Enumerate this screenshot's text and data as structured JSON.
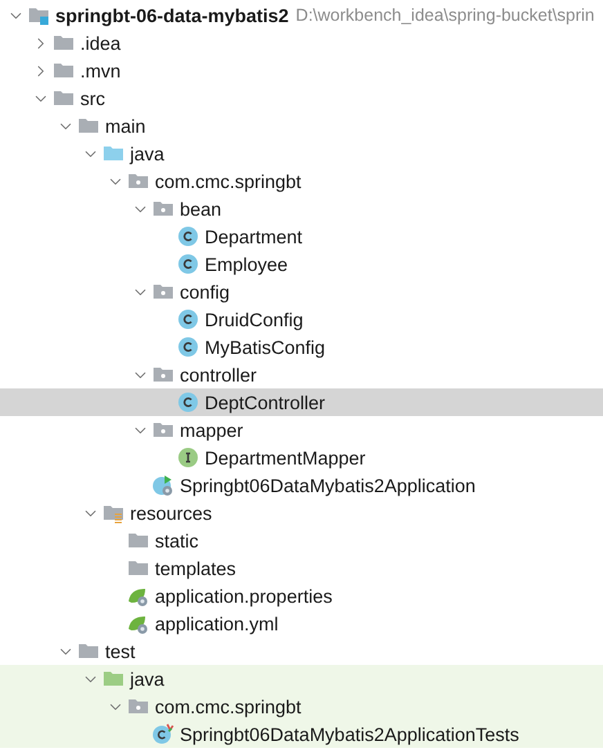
{
  "project_tree": [
    {
      "label": "springbt-06-data-mybatis2",
      "path": "D:\\workbench_idea\\spring-bucket\\sprin",
      "kind": "module",
      "expanded": true,
      "selected": false,
      "tinted": false,
      "children": [
        {
          "label": ".idea",
          "kind": "folder",
          "expanded": false,
          "selected": false,
          "tinted": false
        },
        {
          "label": ".mvn",
          "kind": "folder",
          "expanded": false,
          "selected": false,
          "tinted": false
        },
        {
          "label": "src",
          "kind": "folder",
          "expanded": true,
          "selected": false,
          "tinted": false,
          "children": [
            {
              "label": "main",
              "kind": "folder",
              "expanded": true,
              "selected": false,
              "tinted": false,
              "children": [
                {
                  "label": "java",
                  "kind": "source",
                  "expanded": true,
                  "selected": false,
                  "tinted": false,
                  "children": [
                    {
                      "label": "com.cmc.springbt",
                      "kind": "package",
                      "expanded": true,
                      "selected": false,
                      "tinted": false,
                      "children": [
                        {
                          "label": "bean",
                          "kind": "package",
                          "expanded": true,
                          "selected": false,
                          "tinted": false,
                          "children": [
                            {
                              "label": "Department",
                              "kind": "class",
                              "selected": false,
                              "tinted": false
                            },
                            {
                              "label": "Employee",
                              "kind": "class",
                              "selected": false,
                              "tinted": false
                            }
                          ]
                        },
                        {
                          "label": "config",
                          "kind": "package",
                          "expanded": true,
                          "selected": false,
                          "tinted": false,
                          "children": [
                            {
                              "label": "DruidConfig",
                              "kind": "class",
                              "selected": false,
                              "tinted": false
                            },
                            {
                              "label": "MyBatisConfig",
                              "kind": "class",
                              "selected": false,
                              "tinted": false
                            }
                          ]
                        },
                        {
                          "label": "controller",
                          "kind": "package",
                          "expanded": true,
                          "selected": false,
                          "tinted": false,
                          "children": [
                            {
                              "label": "DeptController",
                              "kind": "class",
                              "selected": true,
                              "tinted": false
                            }
                          ]
                        },
                        {
                          "label": "mapper",
                          "kind": "package",
                          "expanded": true,
                          "selected": false,
                          "tinted": false,
                          "children": [
                            {
                              "label": "DepartmentMapper",
                              "kind": "interface",
                              "selected": false,
                              "tinted": false
                            }
                          ]
                        },
                        {
                          "label": "Springbt06DataMybatis2Application",
                          "kind": "spring-app",
                          "selected": false,
                          "tinted": false
                        }
                      ]
                    }
                  ]
                },
                {
                  "label": "resources",
                  "kind": "resources",
                  "expanded": true,
                  "selected": false,
                  "tinted": false,
                  "children": [
                    {
                      "label": "static",
                      "kind": "folder",
                      "selected": false,
                      "tinted": false
                    },
                    {
                      "label": "templates",
                      "kind": "folder",
                      "selected": false,
                      "tinted": false
                    },
                    {
                      "label": "application.properties",
                      "kind": "spring-config",
                      "selected": false,
                      "tinted": false
                    },
                    {
                      "label": "application.yml",
                      "kind": "spring-config",
                      "selected": false,
                      "tinted": false
                    }
                  ]
                }
              ]
            },
            {
              "label": "test",
              "kind": "folder",
              "expanded": true,
              "selected": false,
              "tinted": false,
              "children": [
                {
                  "label": "java",
                  "kind": "test",
                  "expanded": true,
                  "selected": false,
                  "tinted": true,
                  "children": [
                    {
                      "label": "com.cmc.springbt",
                      "kind": "package",
                      "expanded": true,
                      "selected": false,
                      "tinted": true,
                      "children": [
                        {
                          "label": "Springbt06DataMybatis2ApplicationTests",
                          "kind": "test-class",
                          "selected": false,
                          "tinted": true
                        }
                      ]
                    }
                  ]
                }
              ]
            }
          ]
        }
      ]
    }
  ]
}
